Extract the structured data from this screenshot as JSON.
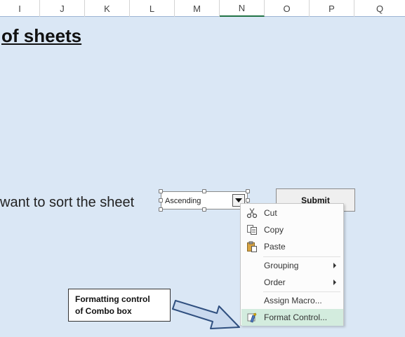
{
  "columns": [
    {
      "letter": "I",
      "width": 57
    },
    {
      "letter": "J",
      "width": 64
    },
    {
      "letter": "K",
      "width": 64
    },
    {
      "letter": "L",
      "width": 64
    },
    {
      "letter": "M",
      "width": 64
    },
    {
      "letter": "N",
      "width": 64
    },
    {
      "letter": "O",
      "width": 64
    },
    {
      "letter": "P",
      "width": 64
    },
    {
      "letter": "Q",
      "width": 72
    }
  ],
  "sheet": {
    "title": "of sheets",
    "sort_prompt": "want to sort the sheet"
  },
  "combo": {
    "value": "Ascending"
  },
  "submit": {
    "label": "Submit"
  },
  "context_menu": {
    "items": [
      {
        "label": "Cut",
        "icon": "scissors-icon",
        "submenu": false
      },
      {
        "label": "Copy",
        "icon": "copy-icon",
        "submenu": false
      },
      {
        "label": "Paste",
        "icon": "paste-icon",
        "submenu": false
      },
      {
        "label": "Grouping",
        "icon": "",
        "submenu": true
      },
      {
        "label": "Order",
        "icon": "",
        "submenu": true
      },
      {
        "label": "Assign Macro...",
        "icon": "",
        "submenu": false
      },
      {
        "label": "Format Control...",
        "icon": "format-control-icon",
        "submenu": false,
        "highlighted": true
      }
    ]
  },
  "callout": {
    "line1": "Formatting control",
    "line2": "of Combo box"
  },
  "colors": {
    "sheet_background": "#dae7f5",
    "highlight": "#d3ecde",
    "selected_column": "#217346",
    "arrow_fill": "#c9d9ee",
    "arrow_stroke": "#2f4f7f"
  }
}
